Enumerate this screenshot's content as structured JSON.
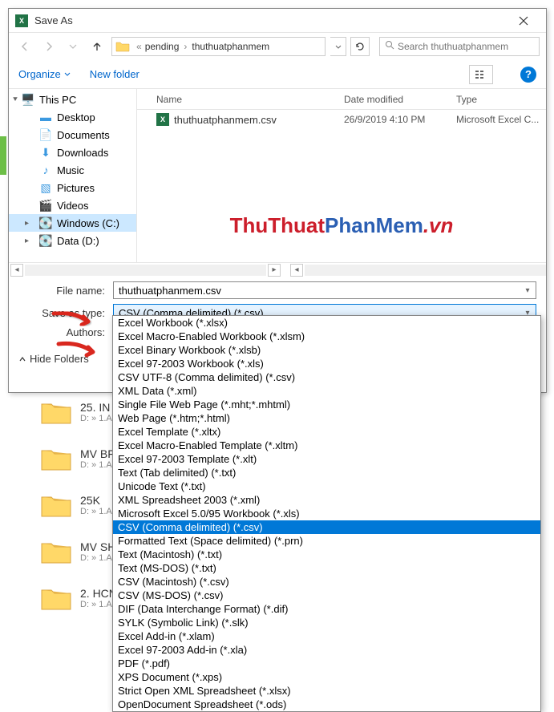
{
  "dialog": {
    "title": "Save As",
    "close_tooltip": "Close"
  },
  "nav": {
    "path_prefix": "«",
    "path_seg1": "pending",
    "path_seg2": "thuthuatphanmem",
    "search_placeholder": "Search thuthuatphanmem"
  },
  "toolbar": {
    "organize": "Organize",
    "new_folder": "New folder"
  },
  "tree": {
    "this_pc": "This PC",
    "desktop": "Desktop",
    "documents": "Documents",
    "downloads": "Downloads",
    "music": "Music",
    "pictures": "Pictures",
    "videos": "Videos",
    "windows_c": "Windows (C:)",
    "data_d": "Data (D:)"
  },
  "columns": {
    "name": "Name",
    "date": "Date modified",
    "type": "Type"
  },
  "files": [
    {
      "name": "thuthuatphanmem.csv",
      "date": "26/9/2019 4:10 PM",
      "type": "Microsoft Excel C..."
    }
  ],
  "form": {
    "file_name_label": "File name:",
    "file_name_value": "thuthuatphanmem.csv",
    "save_as_type_label": "Save as type:",
    "save_as_type_value": "CSV (Comma delimited) (*.csv)",
    "authors_label": "Authors:"
  },
  "bottom": {
    "hide_folders": "Hide Folders"
  },
  "filetype_options": [
    "Excel Workbook (*.xlsx)",
    "Excel Macro-Enabled Workbook (*.xlsm)",
    "Excel Binary Workbook (*.xlsb)",
    "Excel 97-2003 Workbook (*.xls)",
    "CSV UTF-8 (Comma delimited) (*.csv)",
    "XML Data (*.xml)",
    "Single File Web Page (*.mht;*.mhtml)",
    "Web Page (*.htm;*.html)",
    "Excel Template (*.xltx)",
    "Excel Macro-Enabled Template (*.xltm)",
    "Excel 97-2003 Template (*.xlt)",
    "Text (Tab delimited) (*.txt)",
    "Unicode Text (*.txt)",
    "XML Spreadsheet 2003 (*.xml)",
    "Microsoft Excel 5.0/95 Workbook (*.xls)",
    "CSV (Comma delimited) (*.csv)",
    "Formatted Text (Space delimited) (*.prn)",
    "Text (Macintosh) (*.txt)",
    "Text (MS-DOS) (*.txt)",
    "CSV (Macintosh) (*.csv)",
    "CSV (MS-DOS) (*.csv)",
    "DIF (Data Interchange Format) (*.dif)",
    "SYLK (Symbolic Link) (*.slk)",
    "Excel Add-in (*.xlam)",
    "Excel 97-2003 Add-in (*.xla)",
    "PDF (*.pdf)",
    "XPS Document (*.xps)",
    "Strict Open XML Spreadsheet (*.xlsx)",
    "OpenDocument Spreadsheet (*.ods)"
  ],
  "selected_option_index": 15,
  "watermark": {
    "p1": "ThuThuat",
    "p2": "PhanMem",
    "p3": ".vn"
  },
  "explorer": {
    "items": [
      {
        "title": "25. IN",
        "path": "D: » 1.A"
      },
      {
        "title": "MV BF",
        "path": "D: » 1.A"
      },
      {
        "title": "25K",
        "path": "D: » 1.A"
      },
      {
        "title": "MV SH",
        "path": "D: » 1.A"
      },
      {
        "title": "2. HCN",
        "path": "D: » 1.A"
      }
    ]
  }
}
